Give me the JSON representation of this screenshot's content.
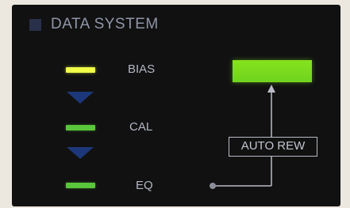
{
  "header": {
    "title": "DATA SYSTEM"
  },
  "steps": [
    {
      "label": "BIAS",
      "indicator": "yellow"
    },
    {
      "label": "CAL",
      "indicator": "green"
    },
    {
      "label": "EQ",
      "indicator": "green"
    }
  ],
  "auto_rew_box": {
    "label": "AUTO REW"
  },
  "colors": {
    "background": "#111111",
    "led_yellow": "#f1ff47",
    "led_green": "#5ac63b",
    "display_green": "#7edb1e",
    "arrow_blue": "#1f3d86",
    "text": "#b3b7c4"
  },
  "icons": {
    "step_arrow": "down-arrow-icon",
    "connector": "arrow-up-connector"
  }
}
